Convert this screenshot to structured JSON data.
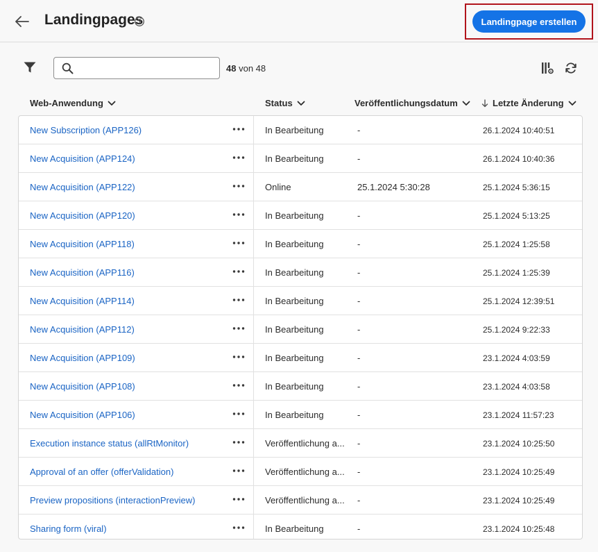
{
  "header": {
    "title": "Landingpages",
    "create_button_label": "Landingpage erstellen"
  },
  "toolbar": {
    "search_placeholder": "",
    "count_shown": "48",
    "count_of": "von 48"
  },
  "table": {
    "columns": [
      {
        "label": "Web-Anwendung"
      },
      {
        "label": "Status"
      },
      {
        "label": "Veröffentlichungsdatum"
      },
      {
        "label": "Letzte Änderung"
      }
    ],
    "rows": [
      {
        "name": "New Subscription (APP126)",
        "status": "In Bearbeitung",
        "published": "-",
        "modified": "26.1.2024 10:40:51"
      },
      {
        "name": "New Acquisition (APP124)",
        "status": "In Bearbeitung",
        "published": "-",
        "modified": "26.1.2024 10:40:36"
      },
      {
        "name": "New Acquisition (APP122)",
        "status": "Online",
        "published": "25.1.2024 5:30:28",
        "modified": "25.1.2024 5:36:15"
      },
      {
        "name": "New Acquisition (APP120)",
        "status": "In Bearbeitung",
        "published": "-",
        "modified": "25.1.2024 5:13:25"
      },
      {
        "name": "New Acquisition (APP118)",
        "status": "In Bearbeitung",
        "published": "-",
        "modified": "25.1.2024 1:25:58"
      },
      {
        "name": "New Acquisition (APP116)",
        "status": "In Bearbeitung",
        "published": "-",
        "modified": "25.1.2024 1:25:39"
      },
      {
        "name": "New Acquisition (APP114)",
        "status": "In Bearbeitung",
        "published": "-",
        "modified": "25.1.2024 12:39:51"
      },
      {
        "name": "New Acquisition (APP112)",
        "status": "In Bearbeitung",
        "published": "-",
        "modified": "25.1.2024 9:22:33"
      },
      {
        "name": "New Acquisition (APP109)",
        "status": "In Bearbeitung",
        "published": "-",
        "modified": "23.1.2024 4:03:59"
      },
      {
        "name": "New Acquisition (APP108)",
        "status": "In Bearbeitung",
        "published": "-",
        "modified": "23.1.2024 4:03:58"
      },
      {
        "name": "New Acquisition (APP106)",
        "status": "In Bearbeitung",
        "published": "-",
        "modified": "23.1.2024 11:57:23"
      },
      {
        "name": "Execution instance status (allRtMonitor)",
        "status": "Veröffentlichung a...",
        "published": "-",
        "modified": "23.1.2024 10:25:50"
      },
      {
        "name": "Approval of an offer (offerValidation)",
        "status": "Veröffentlichung a...",
        "published": "-",
        "modified": "23.1.2024 10:25:49"
      },
      {
        "name": "Preview propositions (interactionPreview)",
        "status": "Veröffentlichung a...",
        "published": "-",
        "modified": "23.1.2024 10:25:49"
      },
      {
        "name": "Sharing form (viral)",
        "status": "In Bearbeitung",
        "published": "-",
        "modified": "23.1.2024 10:25:48"
      }
    ]
  },
  "colors": {
    "accent": "#1473e6",
    "link": "#1a64c4",
    "highlight_frame": "#b1141c"
  },
  "icons": {
    "back": "arrow-left-icon",
    "help": "help-circle-icon",
    "filter": "funnel-icon",
    "search": "magnifier-icon",
    "columns": "column-settings-icon",
    "refresh": "refresh-icon",
    "row_actions": "more-horizontal-icon",
    "sort": "chevron-down-icon",
    "sort_direction": "arrow-down-icon"
  }
}
